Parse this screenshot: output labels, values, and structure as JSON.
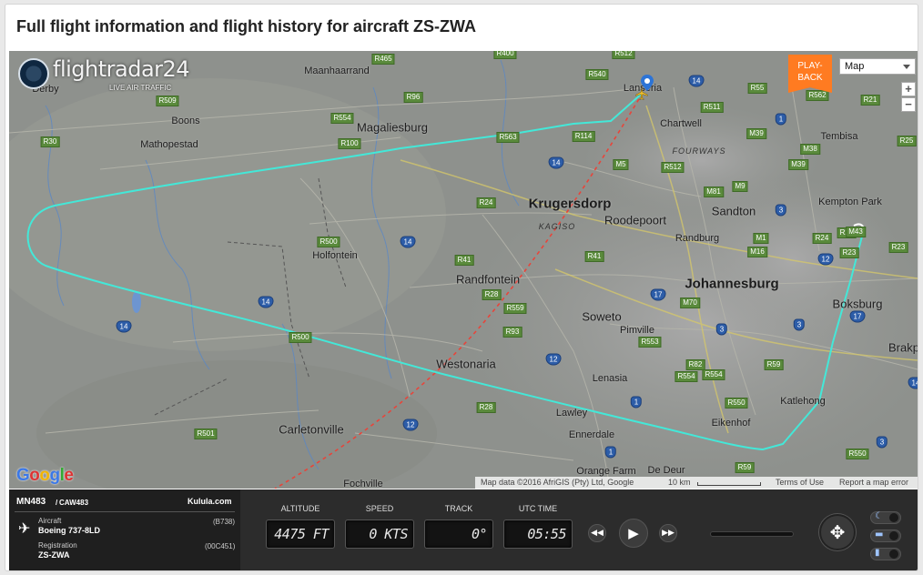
{
  "page": {
    "title": "Full flight information and flight history for aircraft ZS-ZWA"
  },
  "colors": {
    "track": "#43e8d8",
    "planned_route": "#e8443a",
    "route_shield": "#5a8a3c",
    "national_shield": "#2d5da8",
    "playback": "#ff7b21",
    "panel_bg": "#2c2c2c"
  },
  "map": {
    "logo_text": "flightradar24",
    "logo_tagline": "LIVE AIR TRAFFIC",
    "logo_icon": "radar-icon",
    "playback_label": "PLAY-BACK",
    "map_type": "Map",
    "zoom_in": "+",
    "zoom_out": "−",
    "google_logo": "Google",
    "attribution": {
      "data": "Map data ©2016 AfriGIS (Pty) Ltd, Google",
      "scale": "10 km",
      "terms": "Terms of Use",
      "report": "Report a map error"
    },
    "places": [
      {
        "name": "Maanhaarrand"
      },
      {
        "name": "Derby"
      },
      {
        "name": "Magaliesburg"
      },
      {
        "name": "Boons"
      },
      {
        "name": "Mathopestad"
      },
      {
        "name": "Lanseria"
      },
      {
        "name": "Chartwell"
      },
      {
        "name": "Tembisa"
      },
      {
        "name": "FOURWAYS"
      },
      {
        "name": "Krugersdorp"
      },
      {
        "name": "Roodepoort"
      },
      {
        "name": "Sandton"
      },
      {
        "name": "Kempton Park"
      },
      {
        "name": "Randburg"
      },
      {
        "name": "KAGISO"
      },
      {
        "name": "Holfontein"
      },
      {
        "name": "Randfontein"
      },
      {
        "name": "Johannesburg"
      },
      {
        "name": "Boksburg"
      },
      {
        "name": "Soweto"
      },
      {
        "name": "Pimville"
      },
      {
        "name": "Brakp"
      },
      {
        "name": "Westonaria"
      },
      {
        "name": "Lenasia"
      },
      {
        "name": "Lawley"
      },
      {
        "name": "Katlehong"
      },
      {
        "name": "Eikenhof"
      },
      {
        "name": "Ennerdale"
      },
      {
        "name": "Carletonville"
      },
      {
        "name": "Orange Farm"
      },
      {
        "name": "De Deur"
      },
      {
        "name": "Fochville"
      }
    ],
    "route_shields": [
      "R465",
      "R400",
      "R512",
      "R540",
      "R96",
      "R509",
      "R554",
      "R55",
      "R562",
      "R21",
      "R511",
      "R30",
      "R100",
      "R563",
      "R114",
      "M39",
      "M38",
      "R25",
      "M5",
      "R512",
      "M39",
      "R24",
      "M81",
      "M9",
      "R500",
      "R21",
      "M43",
      "R24",
      "M1",
      "R23",
      "R41",
      "R28",
      "M16",
      "R41",
      "R559",
      "M70",
      "R23",
      "R500",
      "R93",
      "R553",
      "R554",
      "R82",
      "R554",
      "R59",
      "R550",
      "R28",
      "R501",
      "R59",
      "R550"
    ],
    "national_shields": [
      "14",
      "1",
      "14",
      "14",
      "14",
      "14",
      "17",
      "3",
      "12",
      "17",
      "3",
      "12",
      "1",
      "3",
      "12",
      "1",
      "3",
      "14"
    ]
  },
  "flight": {
    "flight_number": "MN483",
    "callsign": "CAW483",
    "airline": "Kulula.com",
    "aircraft_label": "Aircraft",
    "aircraft_type": "Boeing 737-8LD",
    "aircraft_code": "(B738)",
    "registration_label": "Registration",
    "registration": "ZS-ZWA",
    "hex": "(00C451)",
    "plane_icon": "airplane-icon"
  },
  "telemetry": {
    "altitude_label": "ALTITUDE",
    "altitude": "4475 FT",
    "speed_label": "SPEED",
    "speed": "0 KTS",
    "track_label": "TRACK",
    "track": "0°",
    "time_label": "UTC TIME",
    "time": "05:55"
  },
  "controls": {
    "rewind_icon": "rewind-icon",
    "play_icon": "play-icon",
    "forward_icon": "fast-forward-icon",
    "center_icon": "crosshair-icon",
    "night_icon": "moon-icon",
    "trail_icon": "trail-icon",
    "stats_icon": "bar-chart-icon"
  }
}
